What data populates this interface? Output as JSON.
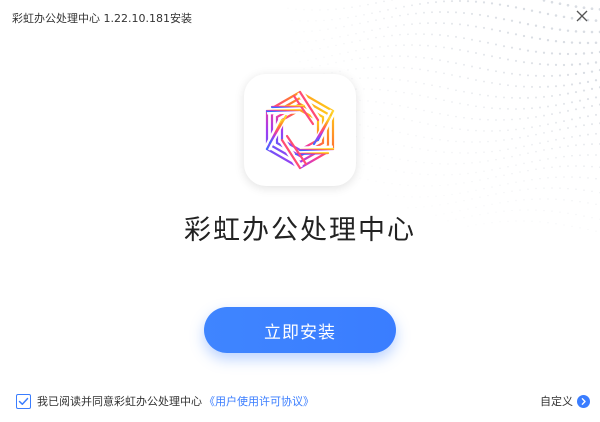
{
  "window": {
    "title": "彩虹办公处理中心 1.22.10.181安装"
  },
  "main": {
    "app_name": "彩虹办公处理中心",
    "install_label": "立即安装"
  },
  "footer": {
    "agree_checked": true,
    "agree_text": "我已阅读并同意彩虹办公处理中心",
    "agree_link": "《用户使用许可协议》",
    "custom_label": "自定义"
  },
  "icons": {
    "close": "close-icon",
    "logo": "rainbow-logo-icon",
    "check": "check-icon",
    "custom": "chevron-right-circle-icon"
  },
  "colors": {
    "accent": "#3a7dff",
    "title_text": "#333333",
    "heading_text": "#222222"
  }
}
